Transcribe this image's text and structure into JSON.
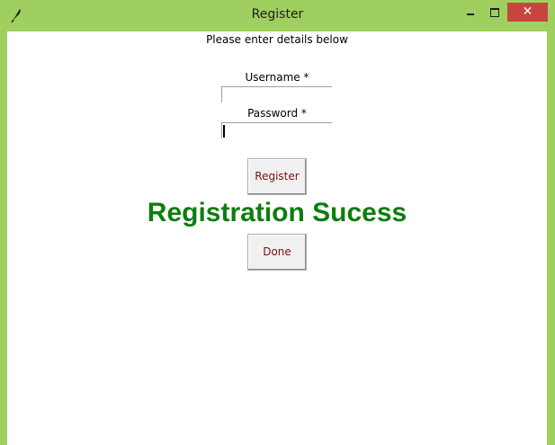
{
  "window": {
    "title": "Register",
    "close_symbol": "✕",
    "icons": {
      "app": "feather-icon",
      "minimize": "minimize-icon",
      "maximize": "maximize-icon",
      "close": "close-icon"
    },
    "colors": {
      "frame": "#9fcf5f",
      "close": "#c7453f"
    }
  },
  "form": {
    "instructions": "Please enter details below",
    "username_label": "Username *",
    "username_value": "",
    "password_label": "Password *",
    "password_value": "",
    "register_label": "Register",
    "success_message": "Registration Sucess",
    "done_label": "Done",
    "colors": {
      "success": "#0e7d0e",
      "button_text": "#7a1010"
    }
  }
}
